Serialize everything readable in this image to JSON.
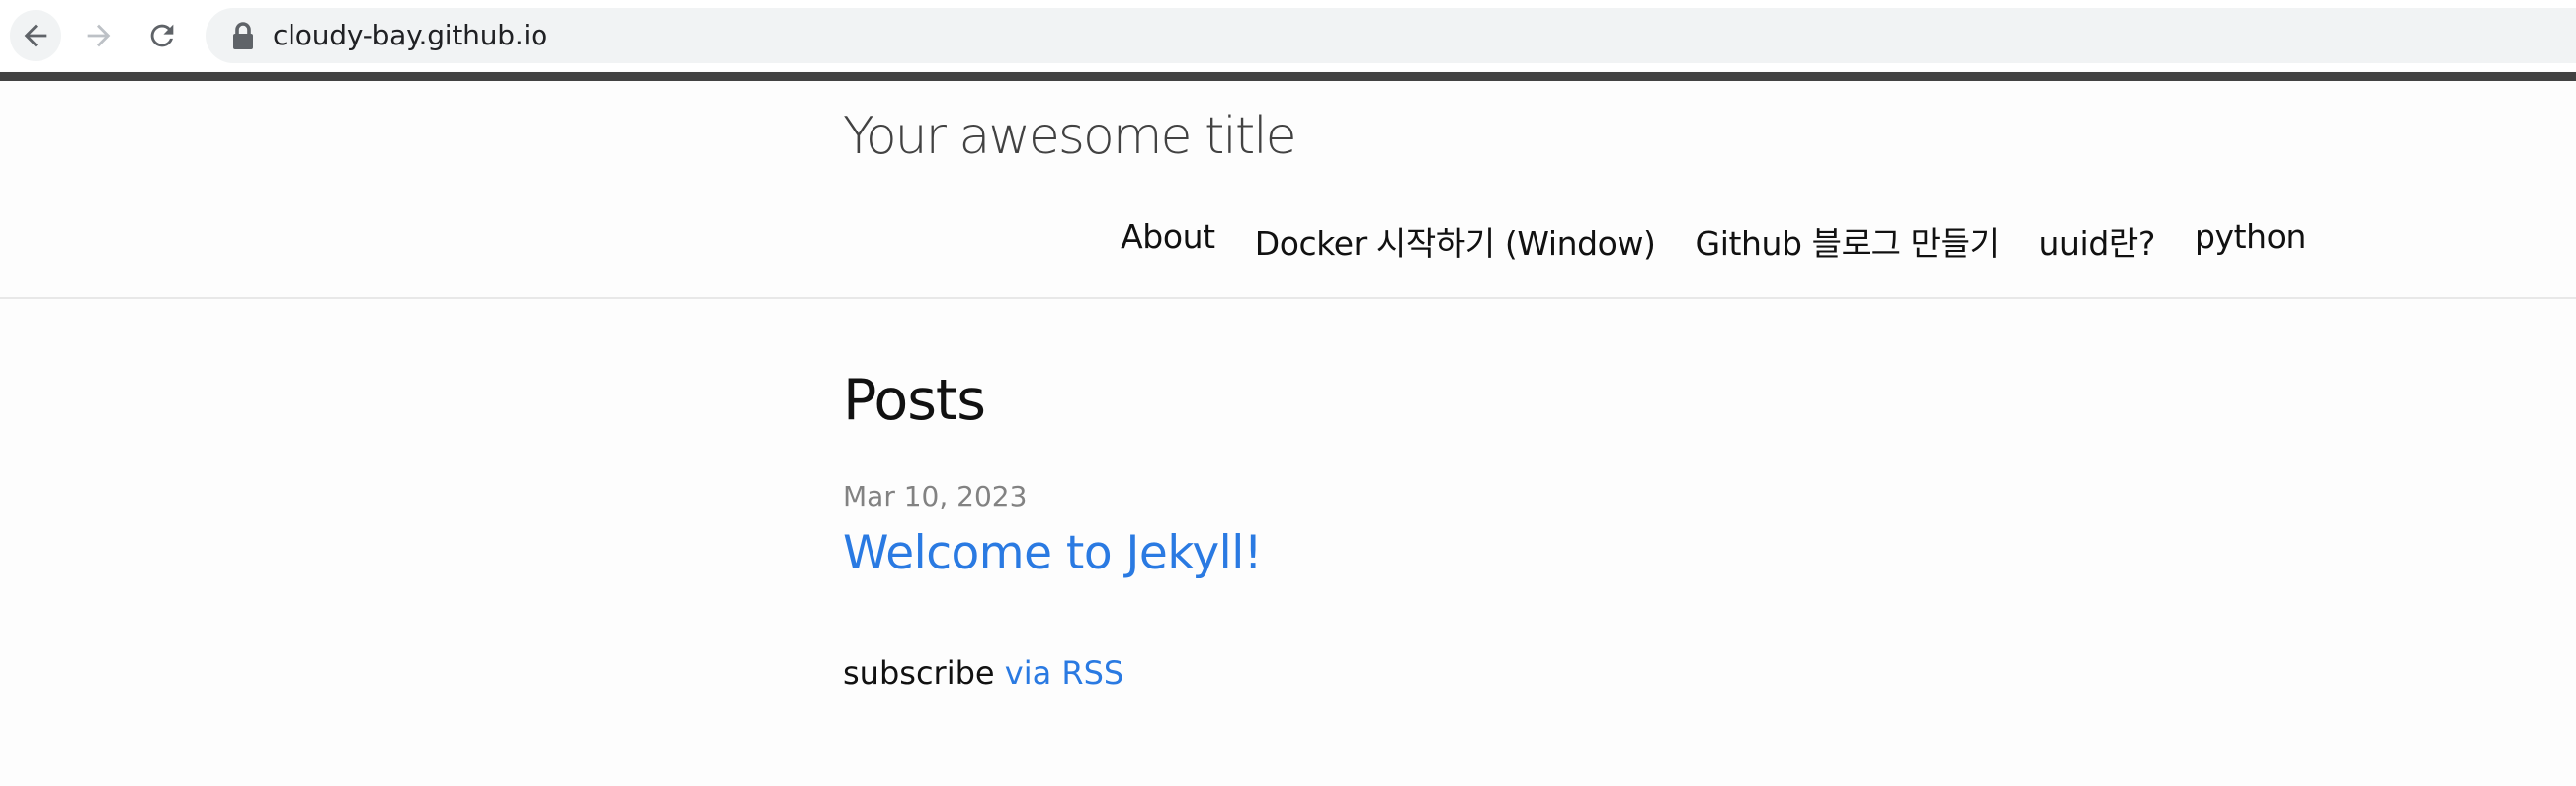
{
  "browser": {
    "url": "cloudy-bay.github.io",
    "icons": {
      "back": "arrow-left-icon",
      "forward": "arrow-right-icon",
      "reload": "reload-icon",
      "lock": "lock-icon"
    }
  },
  "header": {
    "site_title": "Your awesome title",
    "nav": [
      {
        "label": "About"
      },
      {
        "label": "Docker 시작하기 (Window)"
      },
      {
        "label": "Github 블로그 만들기"
      },
      {
        "label": "uuid란?"
      },
      {
        "label": "python"
      }
    ]
  },
  "main": {
    "heading": "Posts",
    "posts": [
      {
        "date": "Mar 10, 2023",
        "title": "Welcome to Jekyll!"
      }
    ],
    "subscribe_text": "subscribe",
    "rss_label": "via RSS"
  },
  "colors": {
    "link": "#2a7ae2",
    "text": "#111111",
    "meta": "#828282",
    "top_rule": "#424242",
    "background": "#fdfdfd"
  }
}
